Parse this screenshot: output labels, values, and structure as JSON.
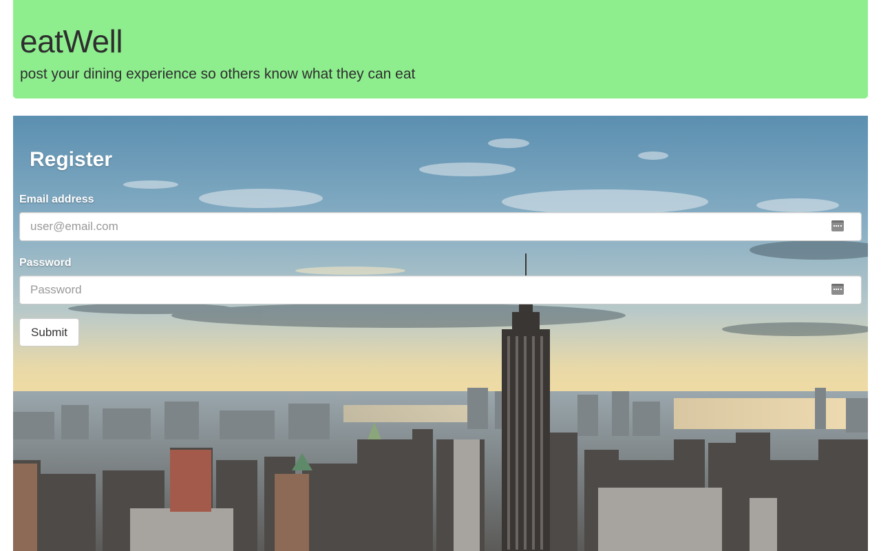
{
  "header": {
    "brand": "eatWell",
    "tagline": "post your dining experience so others know what they can eat",
    "background_color": "#8eee8e"
  },
  "register_form": {
    "title": "Register",
    "email": {
      "label": "Email address",
      "placeholder": "user@email.com",
      "value": "",
      "icon": "keychain-autofill-icon"
    },
    "password": {
      "label": "Password",
      "placeholder": "Password",
      "value": "",
      "icon": "keychain-autofill-icon"
    },
    "submit_label": "Submit"
  },
  "background": {
    "scene": "city-skyline-photo"
  }
}
